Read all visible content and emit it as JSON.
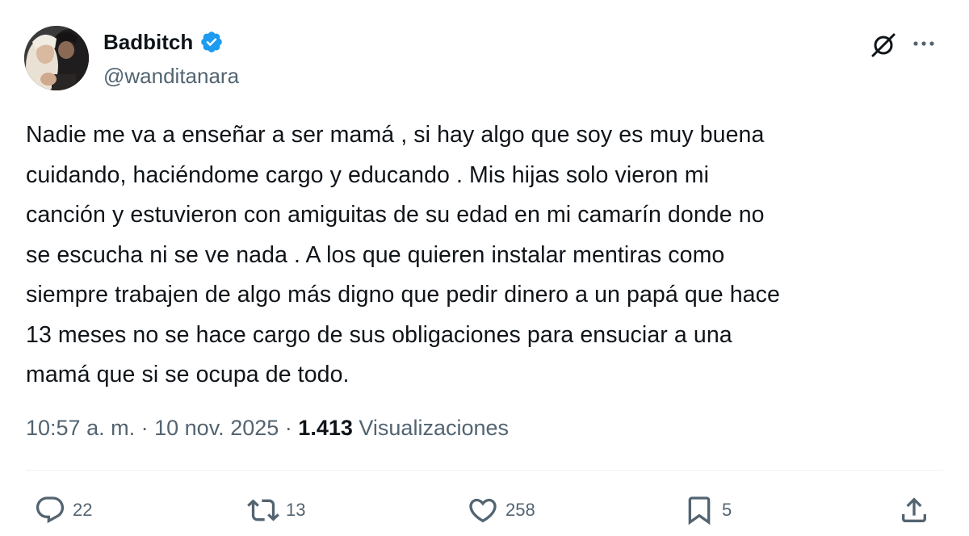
{
  "author": {
    "name": "Badbitch",
    "handle": "@wanditanara",
    "verified": true,
    "verified_color": "#1d9bf0"
  },
  "header_icons": [
    "grok-icon",
    "more-options-icon"
  ],
  "tweet": {
    "text": "Nadie me va a enseñar a ser mamá , si hay algo que soy es muy buena\ncuidando, haciéndome cargo y educando . Mis hijas solo vieron mi\ncanción y estuvieron con amiguitas de su edad en mi camarín donde no\nse escucha ni se ve nada . A los que quieren instalar mentiras como\nsiempre trabajen de algo más digno que pedir dinero a un papá que hace\n13 meses no se hace cargo de sus obligaciones para ensuciar a una\nmamá que si se ocupa de todo."
  },
  "meta": {
    "time": "10:57 a. m.",
    "separator": "·",
    "date": "10 nov. 2025",
    "views_count": "1.413",
    "views_label": "Visualizaciones"
  },
  "actions": {
    "reply": {
      "icon": "reply-icon",
      "count": "22"
    },
    "retweet": {
      "icon": "retweet-icon",
      "count": "13"
    },
    "like": {
      "icon": "heart-icon",
      "count": "258"
    },
    "bookmark": {
      "icon": "bookmark-icon",
      "count": "5"
    },
    "share": {
      "icon": "share-icon"
    }
  },
  "colors": {
    "text_primary": "#0f1419",
    "text_secondary": "#536471",
    "divider": "#eff3f4",
    "verified": "#1d9bf0"
  }
}
